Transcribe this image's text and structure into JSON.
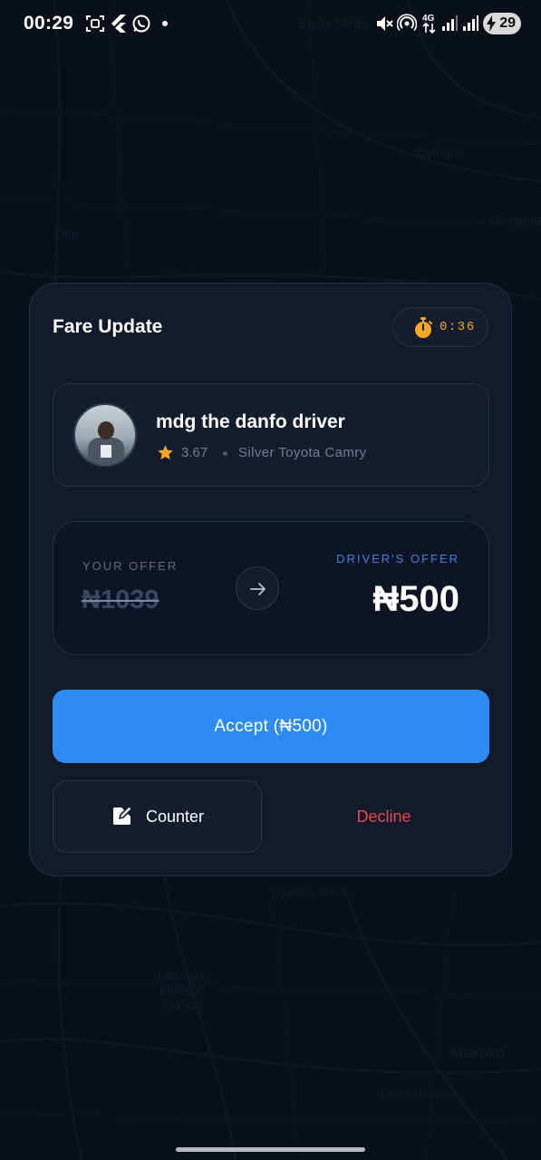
{
  "status_bar": {
    "time": "00:29",
    "battery": "29",
    "network": "4G"
  },
  "map_labels": [
    "Ebute Metta",
    "Oyingbo",
    "Otto",
    "Obalende",
    "Mobolaji Johnson Station",
    "Makoko",
    "Lagos Mainland",
    "Ogunlana Street"
  ],
  "card": {
    "title": "Fare Update",
    "timer": "0:36",
    "driver": {
      "name": "mdg the danfo driver",
      "rating": "3.67",
      "car": "Silver Toyota Camry"
    },
    "your_offer": {
      "label": "YOUR OFFER",
      "value": "₦1039"
    },
    "driver_offer": {
      "label": "DRIVER'S OFFER",
      "value": "₦500"
    },
    "accept_label": "Accept (₦500)",
    "counter_label": "Counter",
    "decline_label": "Decline"
  },
  "colors": {
    "accent": "#2d8cf4",
    "timer": "#f5a623",
    "decline": "#e24b4b",
    "card_bg": "#111a2a"
  },
  "icons": {
    "timer": "stopwatch-icon",
    "rating": "star-icon",
    "arrow": "arrow-right-icon",
    "counter": "edit-icon"
  }
}
